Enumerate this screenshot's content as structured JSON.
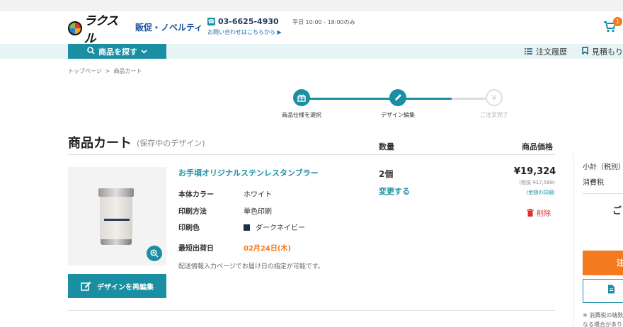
{
  "header": {
    "logo_text": "ラクスル",
    "tagline": "販促・ノベルティ",
    "phone": "03-6625-4930",
    "hours": "平日 10:00 - 18:00のみ",
    "inquiry": "お問い合わせはこちらから ▶",
    "cart_count": "1"
  },
  "nav": {
    "search_label": "商品を探す",
    "order_history": "注文履歴",
    "quotes": "見積もり"
  },
  "breadcrumb": [
    "トップページ",
    "商品カート"
  ],
  "steps": [
    {
      "label": "商品仕様を選択",
      "state": "done"
    },
    {
      "label": "デザイン編集",
      "state": "current"
    },
    {
      "label": "ご注文完了",
      "state": "pending"
    }
  ],
  "cart": {
    "title": "商品カート",
    "subtitle": "(保存中のデザイン)",
    "col_qty": "数量",
    "col_price": "商品価格",
    "item": {
      "name": "お手頃オリジナルステンレスタンブラー",
      "attributes": [
        {
          "label": "本体カラー",
          "value": "ホワイト"
        },
        {
          "label": "印刷方法",
          "value": "単色印刷"
        },
        {
          "label": "印刷色",
          "value": "ダークネイビー"
        }
      ],
      "ship_label": "最短出荷日",
      "ship_date": "02月24日(木)",
      "delivery_note": "配送情報入力ページでお届け日の指定が可能です。",
      "qty": "2個",
      "qty_change": "変更する",
      "price": "¥19,324",
      "price_tax": "(税抜 ¥17,568)",
      "price_detail": "(金額の詳細)",
      "delete": "削除",
      "redesign": "デザインを再編集"
    }
  },
  "summary": {
    "subtotal": "小計（税別）",
    "tax": "消費税",
    "total_partial": "ご",
    "order_partial": "注",
    "note_line1": "※ 消費税の端数",
    "note_line2": "なる場合があり"
  },
  "colors": {
    "accent": "#1a8fa3",
    "orange": "#f47a20",
    "delete_red": "#d9322e",
    "swatch_navy": "#1f2d4a"
  }
}
